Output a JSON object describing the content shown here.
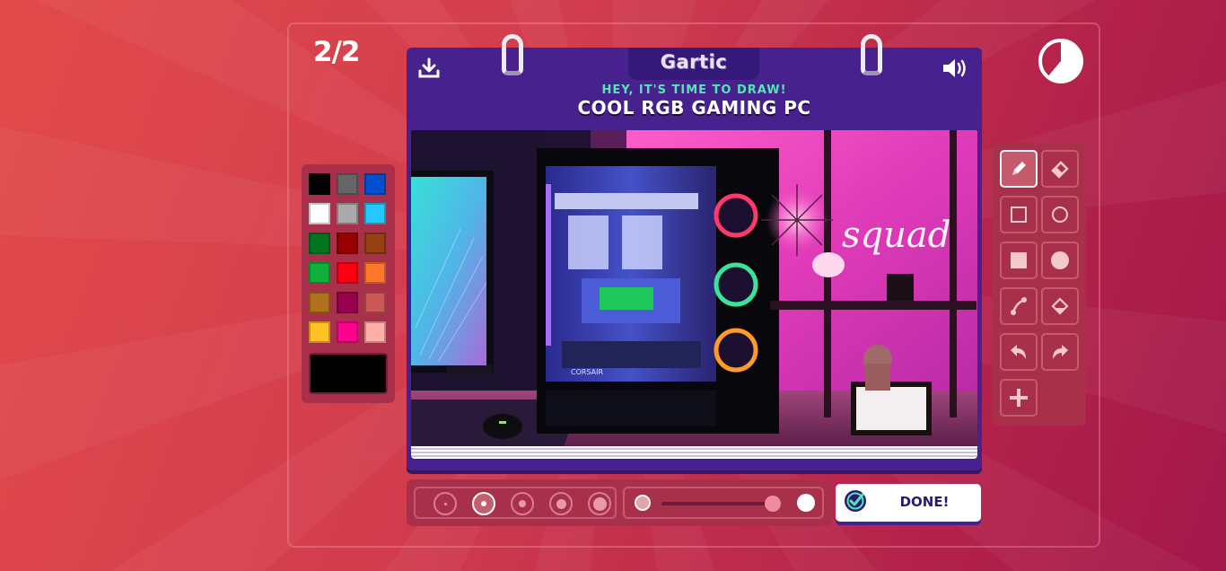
{
  "round": {
    "counter": "2/2"
  },
  "timer": {
    "remaining_fraction": 0.61
  },
  "palette": {
    "colors": [
      "#000000",
      "#666666",
      "#0050cd",
      "#ffffff",
      "#aaaaaa",
      "#26c9ff",
      "#017420",
      "#990000",
      "#964112",
      "#11b03c",
      "#ff0013",
      "#ff7829",
      "#b0701c",
      "#99004e",
      "#cb5a57",
      "#ffc126",
      "#ff008f",
      "#feafa8"
    ],
    "selected": "#000000"
  },
  "card": {
    "logo": "Gartic",
    "subtitle": "HEY, IT'S TIME TO DRAW!",
    "title": "COOL RGB GAMING PC",
    "drawing_text": "squad",
    "pc_brand_text": "CORSAIR"
  },
  "tools": [
    {
      "name": "pencil-tool",
      "icon": "pencil-icon",
      "active": true
    },
    {
      "name": "eraser-tool",
      "icon": "eraser-icon",
      "active": false
    },
    {
      "name": "rectangle-outline-tool",
      "icon": "square-outline-icon",
      "active": false
    },
    {
      "name": "ellipse-outline-tool",
      "icon": "circle-outline-icon",
      "active": false
    },
    {
      "name": "rectangle-fill-tool",
      "icon": "square-filled-icon",
      "active": false
    },
    {
      "name": "ellipse-fill-tool",
      "icon": "circle-filled-icon",
      "active": false
    },
    {
      "name": "line-tool",
      "icon": "line-icon",
      "active": false
    },
    {
      "name": "fill-bucket-tool",
      "icon": "bucket-icon",
      "active": false
    },
    {
      "name": "undo-tool",
      "icon": "undo-icon",
      "active": false
    },
    {
      "name": "redo-tool",
      "icon": "redo-icon",
      "active": false
    },
    {
      "name": "add-layer-tool",
      "icon": "plus-icon",
      "active": false
    }
  ],
  "brush_sizes": {
    "count": 5,
    "selected_index": 1
  },
  "opacity": {
    "value": 0.95
  },
  "done_button": {
    "label": "DONE!"
  }
}
